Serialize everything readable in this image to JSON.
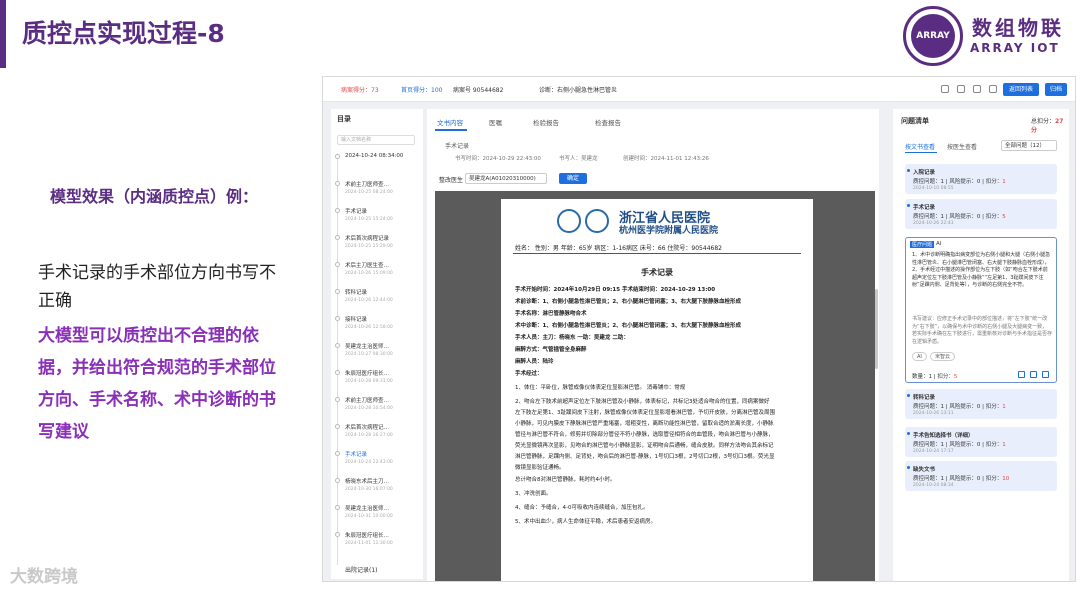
{
  "slide": {
    "title": "质控点实现过程-8",
    "brand_cn": "数组物联",
    "brand_en": "ARRAY IOT",
    "logo_text": "ARRAY",
    "subtitle": "模型效果（内涵质控点）例：",
    "description": "手术记录的手术部位方向书写不正确",
    "highlight": "大模型可以质控出不合理的依据，并给出符合规范的手术部位方向、手术名称、术中诊断的书写建议",
    "watermark": "大数跨境"
  },
  "app": {
    "topbar": {
      "score1": "病案得分：73",
      "score2": "首页得分：100",
      "record_no": "病案号 90544682",
      "diagnosis": "诊断：右侧小腿急性淋巴管炎",
      "btn_back": "返回列表",
      "btn_return": "归档"
    },
    "sidebar": {
      "title": "目录",
      "search_placeholder": "输入文档名称",
      "items": [
        {
          "label": "2024-10-24 08:34:00",
          "date": ""
        },
        {
          "label": "术前主刀医师查…",
          "date": "2024-10-25 08:24:00"
        },
        {
          "label": "手术记录",
          "date": "2024-10-25 15:24:00"
        },
        {
          "label": "术后首次病程记录",
          "date": "2024-10-25 15:29:00"
        },
        {
          "label": "术后主刀医生查…",
          "date": "2024-10-26 15:09:00"
        },
        {
          "label": "转科记录",
          "date": "2024-10-26 12:44:00"
        },
        {
          "label": "接科记录",
          "date": "2024-10-26 12:58:00"
        },
        {
          "label": "吴建龙主治医师…",
          "date": "2024-10-27 08:30:00"
        },
        {
          "label": "朱辰冠医疗组长…",
          "date": "2024-10-28 09:31:00"
        },
        {
          "label": "术前主刀医师查…",
          "date": "2024-10-28 10:54:00"
        },
        {
          "label": "术后首次病程记…",
          "date": "2024-10-28 16:27:00"
        },
        {
          "label": "手术记录",
          "date": "2024-10-24 22:43:00"
        },
        {
          "label": "杨晓东术后主刀…",
          "date": "2024-10-30 16:07:00"
        },
        {
          "label": "吴建龙主治医师…",
          "date": "2024-10-31 10:00:00"
        },
        {
          "label": "朱辰冠医疗组长…",
          "date": "2024-11-01 11:30:00"
        }
      ],
      "footer": "出院记录(1)"
    },
    "tabs": [
      "文书内容",
      "医嘱",
      "检验报告",
      "检查报告"
    ],
    "record": {
      "name": "手术记录",
      "write_time": "书写时间：2024-10-29 22:43:00",
      "writer": "书写人：吴建龙",
      "create_time": "创建时间：2024-11-01 12:43:26",
      "fix_label": "整改医生",
      "doctor_select": "吴建龙A(A01020310000)",
      "confirm_btn": "确定"
    },
    "document": {
      "hospital_cn": "浙江省人民医院",
      "hospital_sub": "杭州医学院附属人民医院",
      "patient_info": "姓名：        性别：男   年龄：65岁    病区：1-16病区    床号：66  住院号：90544682",
      "title": "手术记录",
      "lines": [
        "手术开始时间：2024年10月29日 09:15  手术结束时间：2024-10-29 13:00",
        "术前诊断：1、右侧小腿急性淋巴管炎；2、右小腿淋巴管闭塞；3、右大腿下肢静脉血栓形成",
        "手术名称：淋巴管静脉吻合术",
        "术中诊断：1、右侧小腿急性淋巴管炎；2、右小腿淋巴管闭塞；3、右大腿下肢静脉血栓形成",
        "手术人员：主刀：杨晓东  一助：吴建龙  二助：",
        "麻醉方式：气管插管全身麻醉",
        "麻醉人员：陆玲",
        "手术经过：",
        "1、体位：平卧位，脉管成像仪体表定位显影淋巴管。     消毒铺巾：常规",
        "2、吻合左下肢术前超声定位左下肢淋巴管及小静脉，体表标记，共标记3处适合吻合的位置，同病案做好",
        "左下肢左足第1、3趾蹼间皮下注射，脉管成像仪体表定位显影增看淋巴管，予切开皮肤，分离淋巴管及周围",
        "小静脉，可见内膜皮下静脉淋巴管严重堵塞，增粗变性，离断功能性淋巴管，留取合适的淤离长度，小静脉",
        "管径与淋巴管不符合，修剪并切除部分管径不符小静脉，选取管径相符合的血管段，吻合淋巴管与小静脉，",
        "荧光显微镜再次显影，见吻合的淋巴管与小静脉显影，证明吻合后通畅，缝合皮肤。同样方法吻合其余标记",
        "淋巴管静脉，足踝内侧、足背处，吻合后的淋巴管-静脉，1号切口3根，2号切口2根，3号切口3根。荧光显",
        "微镜显影验证通畅。",
        "总计吻合8对淋巴管静脉，耗时约4小时。",
        "3、冲洗创面。",
        "4、缝合：予缝合，4-0可吸收内连续缝合，加压包扎。",
        "5、术中出血少，病人生命体征平稳，术后患者安返病房。"
      ]
    },
    "right": {
      "title": "问题清单",
      "total": "总扣分：",
      "total_value": "27分",
      "tab1": "按文书查看",
      "tab2": "按医生查看",
      "filter": "全部问题（12）",
      "cards": [
        {
          "title": "入院记录",
          "q": "质控问题：1  | 风险提示：0  | 扣分：",
          "score": "1",
          "date": "2024-10-10 08:55"
        },
        {
          "title": "手术记录",
          "q": "质控问题：1  | 风险提示：0  | 扣分：",
          "score": "5",
          "date": "2024-10-26 22:43"
        },
        {
          "title": "转科记录",
          "q": "质控问题：1  | 风险提示：0  | 扣分：",
          "score": "1",
          "date": "2024-10-26 13:11"
        },
        {
          "title": "手术告知选择书（详细）",
          "q": "质控问题：1  | 风险提示：0  | 扣分：",
          "score": "1",
          "date": "2024-10-24 17:17"
        },
        {
          "title": "缺失文书",
          "q": "质控问题：1  | 风险提示：0  | 扣分：",
          "score": "10",
          "date": "2024-10-24 08:34"
        }
      ],
      "ai": {
        "tag": "医疗问题",
        "tag2": "AI",
        "text": "1、术中诊断明确指出病变部位为右侧小腿和大腿（右侧小腿急性淋巴管炎、右小腿淋巴管闭塞、右大腿下肢静脉血栓形成），2、手术经过中描述的操作部位为左下肢（如“吻合左下肢术前超声定位左下肢淋巴管及小静脉”“左足第1、3趾蹼间皮下注射”足踝内侧、足背处等），与诊断的右侧完全不符。",
        "suggestion": "书写建议：应修正手术记录中的部位描述，将“左下肢”统一改为“右下肢”，以确保与术中诊断的右侧小腿及大腿病变一致，若实际手术确在左下肢进行，需重新核对诊断与手术指征是否存在逻辑矛盾。",
        "chip1": "AI",
        "chip2": "米智云",
        "count": "数量：1  | 扣分：",
        "count_score": "5"
      }
    }
  }
}
